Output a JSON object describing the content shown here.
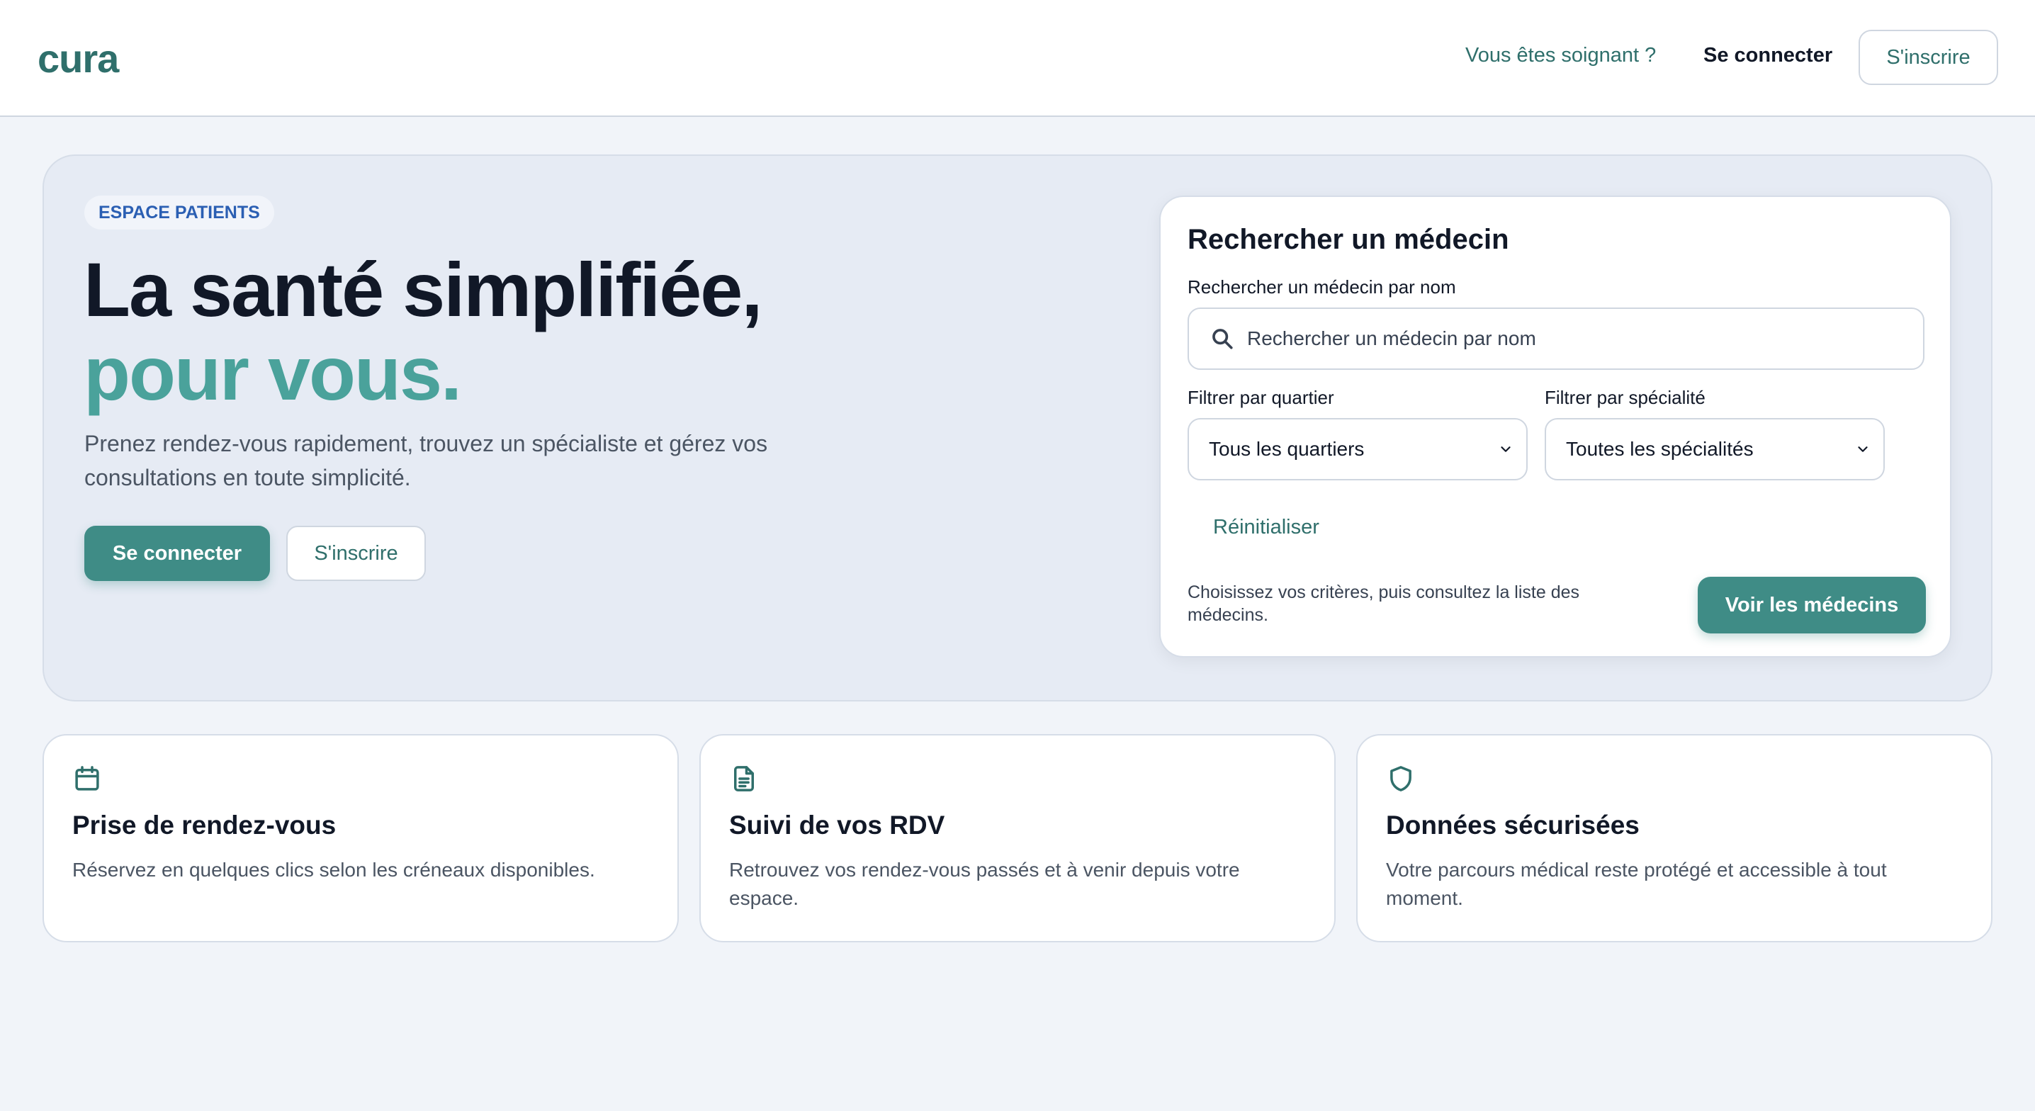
{
  "header": {
    "logo": "cura",
    "nav_soignant": "Vous êtes soignant ?",
    "nav_login": "Se connecter",
    "nav_signup": "S'inscrire"
  },
  "hero": {
    "badge": "ESPACE PATIENTS",
    "title_line1": "La santé simplifiée,",
    "title_line2": "pour vous.",
    "description": "Prenez rendez-vous rapidement, trouvez un spécialiste et gérez vos consultations en toute simplicité.",
    "btn_login": "Se connecter",
    "btn_signup": "S'inscrire"
  },
  "search": {
    "title": "Rechercher un médecin",
    "name_label": "Rechercher un médecin par nom",
    "name_placeholder": "Rechercher un médecin par nom",
    "quartier_label": "Filtrer par quartier",
    "quartier_value": "Tous les quartiers",
    "specialite_label": "Filtrer par spécialité",
    "specialite_value": "Toutes les spécialités",
    "reset": "Réinitialiser",
    "hint": "Choisissez vos critères, puis consultez la liste des médecins.",
    "cta": "Voir les médecins"
  },
  "features": [
    {
      "icon": "calendar-icon",
      "title": "Prise de rendez-vous",
      "description": "Réservez en quelques clics selon les créneaux disponibles."
    },
    {
      "icon": "document-icon",
      "title": "Suivi de vos RDV",
      "description": "Retrouvez vos rendez-vous passés et à venir depuis votre espace."
    },
    {
      "icon": "shield-icon",
      "title": "Données sécurisées",
      "description": "Votre parcours médical reste protégé et accessible à tout moment."
    }
  ],
  "colors": {
    "brand": "#2f6f6b",
    "accent": "#4aa29b",
    "primary_button": "#3f8c86",
    "badge_text": "#2b5fb3"
  }
}
